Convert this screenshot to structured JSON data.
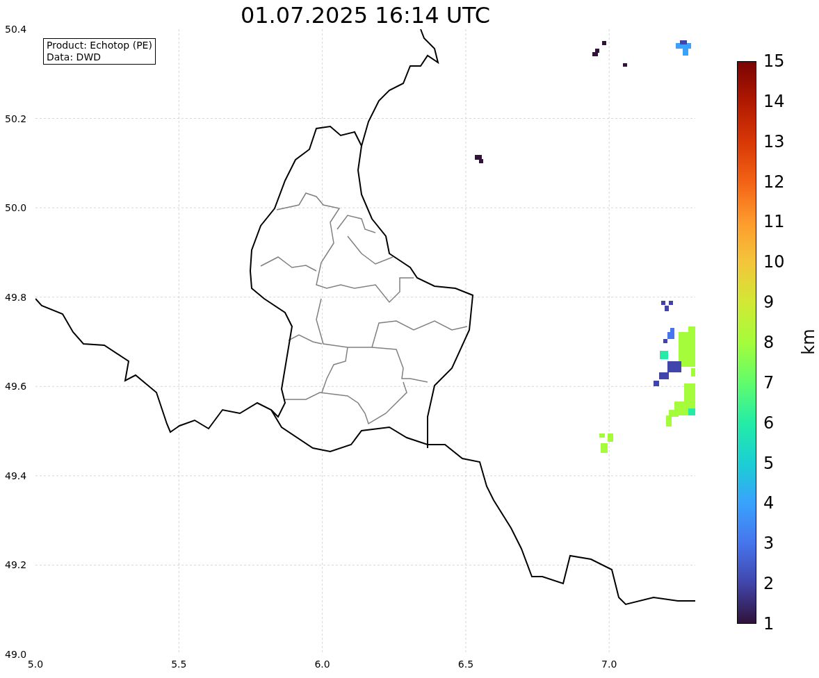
{
  "title": "01.07.2025 16:14 UTC",
  "info_box": [
    "Product: Echotop (PE)",
    "Data: DWD"
  ],
  "x_ticks": [
    "5.0",
    "5.5",
    "6.0",
    "6.5",
    "7.0"
  ],
  "y_ticks": [
    "50.4",
    "50.2",
    "50.0",
    "49.8",
    "49.6",
    "49.4",
    "49.2",
    "49.0"
  ],
  "colorbar": {
    "label": "km",
    "ticks": [
      "15",
      "14",
      "13",
      "12",
      "11",
      "10",
      "9",
      "8",
      "7",
      "6",
      "5",
      "4",
      "3",
      "2",
      "1"
    ]
  }
}
